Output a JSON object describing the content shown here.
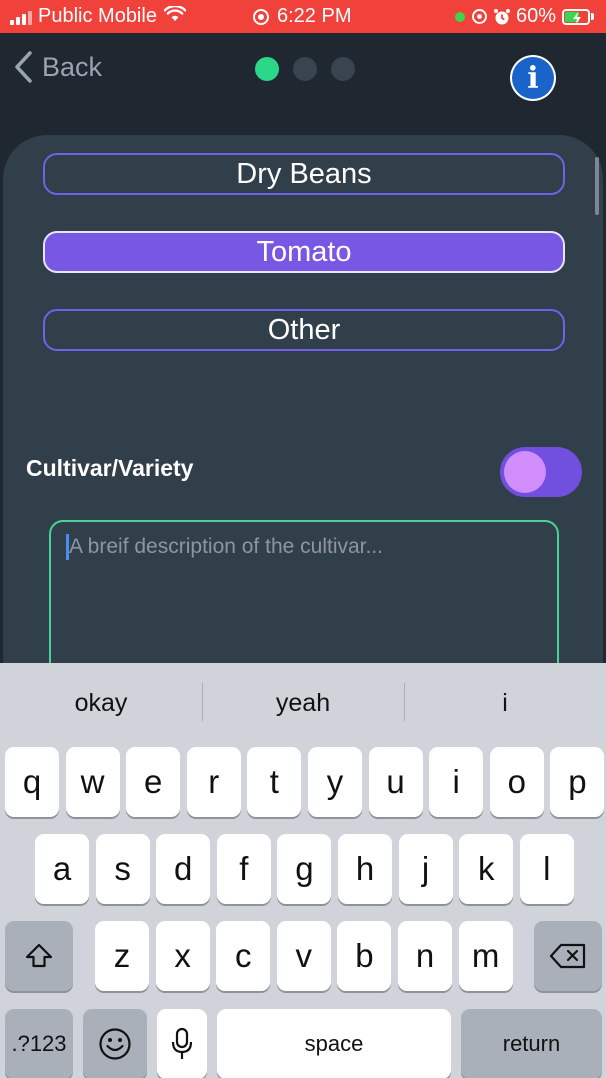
{
  "status_bar": {
    "carrier": "Public Mobile",
    "time": "6:22 PM",
    "battery": "60%",
    "battery_level": 0.6
  },
  "nav": {
    "back_label": "Back",
    "pager": {
      "total": 3,
      "active_index": 0
    },
    "info_label": "i"
  },
  "crop_options": [
    {
      "label": "Dry Beans",
      "selected": false
    },
    {
      "label": "Tomato",
      "selected": true
    },
    {
      "label": "Other",
      "selected": false
    }
  ],
  "cultivar": {
    "label": "Cultivar/Variety",
    "toggle_on": true,
    "description_value": "",
    "description_placeholder": "A breif description of the cultivar..."
  },
  "keyboard": {
    "suggestions": [
      "okay",
      "yeah",
      "i"
    ],
    "row1": [
      "q",
      "w",
      "e",
      "r",
      "t",
      "y",
      "u",
      "i",
      "o",
      "p"
    ],
    "row2": [
      "a",
      "s",
      "d",
      "f",
      "g",
      "h",
      "j",
      "k",
      "l"
    ],
    "row3": [
      "z",
      "x",
      "c",
      "v",
      "b",
      "n",
      "m"
    ],
    "numbers_label": ".?123",
    "space_label": "space",
    "return_label": "return"
  },
  "colors": {
    "status_bar": "#f0413a",
    "background": "#1f2730",
    "card": "#313f4b",
    "accent_purple": "#7757e3",
    "pager_active": "#2bd88a",
    "input_border": "#46d49c",
    "info_blue": "#1a63c9"
  },
  "icons": [
    "signal-icon",
    "wifi-icon",
    "focus-icon",
    "location-icon",
    "alarm-icon",
    "battery-icon",
    "back-chevron-icon",
    "info-icon",
    "shift-icon",
    "backspace-icon",
    "emoji-icon",
    "microphone-icon"
  ]
}
